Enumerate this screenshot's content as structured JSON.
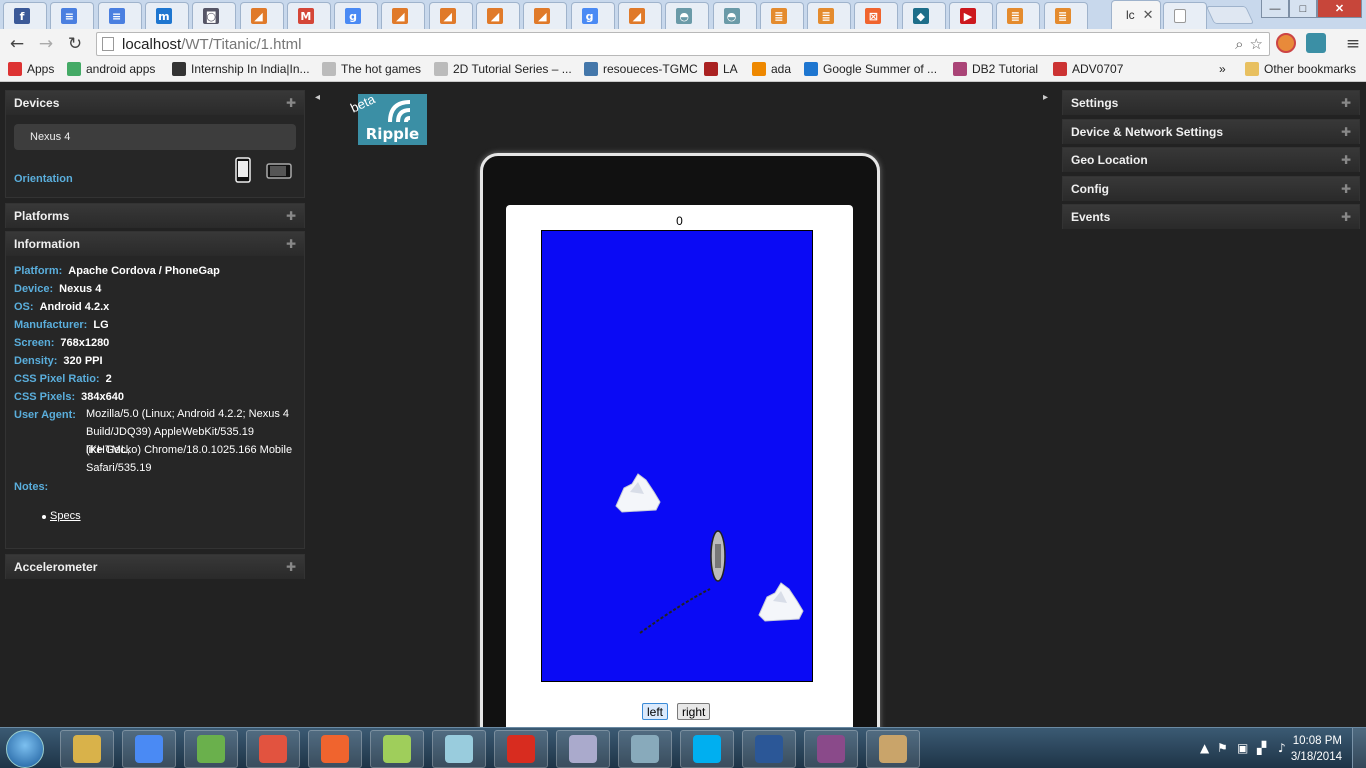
{
  "window": {
    "active_tab_title": "lc",
    "controls": {
      "minimize": "—",
      "maximize": "□",
      "close": "✕"
    }
  },
  "tabs": [
    {
      "icon": "facebook-icon",
      "color": "#3b5998",
      "glyph": "f"
    },
    {
      "icon": "docs-icon",
      "color": "#4a7fe0",
      "glyph": "≡"
    },
    {
      "icon": "docs-icon",
      "color": "#4a7fe0",
      "glyph": "≡"
    },
    {
      "icon": "m-icon",
      "color": "#1e76d0",
      "glyph": "m"
    },
    {
      "icon": "download-icon",
      "color": "#556",
      "glyph": "◙"
    },
    {
      "icon": "blogger-icon",
      "color": "#e07a2a",
      "glyph": "◢"
    },
    {
      "icon": "gmail-icon",
      "color": "#d44638",
      "glyph": "M"
    },
    {
      "icon": "google-icon",
      "color": "#4a8af4",
      "glyph": "g"
    },
    {
      "icon": "blogger-icon",
      "color": "#e07a2a",
      "glyph": "◢"
    },
    {
      "icon": "blogger-icon",
      "color": "#e07a2a",
      "glyph": "◢"
    },
    {
      "icon": "blogger-icon",
      "color": "#e07a2a",
      "glyph": "◢"
    },
    {
      "icon": "blogger-icon",
      "color": "#e07a2a",
      "glyph": "◢"
    },
    {
      "icon": "google-icon",
      "color": "#4a8af4",
      "glyph": "g"
    },
    {
      "icon": "blogger-icon",
      "color": "#e07a2a",
      "glyph": "◢"
    },
    {
      "icon": "ripple-icon",
      "color": "#6a9aa8",
      "glyph": "◓"
    },
    {
      "icon": "ripple-icon",
      "color": "#6a9aa8",
      "glyph": "◓"
    },
    {
      "icon": "stackoverflow-icon",
      "color": "#e48b2e",
      "glyph": "≣"
    },
    {
      "icon": "stackoverflow-icon",
      "color": "#e48b2e",
      "glyph": "≣"
    },
    {
      "icon": "xampp-icon",
      "color": "#f0642e",
      "glyph": "⊠"
    },
    {
      "icon": "app-icon",
      "color": "#1d6e8a",
      "glyph": "◆"
    },
    {
      "icon": "youtube-icon",
      "color": "#cc181e",
      "glyph": "▶"
    },
    {
      "icon": "stackoverflow-icon",
      "color": "#e48b2e",
      "glyph": "≣"
    },
    {
      "icon": "stackoverflow-icon",
      "color": "#e48b2e",
      "glyph": "≣"
    }
  ],
  "toolbar": {
    "url_host": "localhost",
    "url_path": "/WT/Titanic/1.html"
  },
  "bookmarks": [
    {
      "label": "Apps",
      "icon": "apps-grid-icon",
      "color": "#d33"
    },
    {
      "label": "android apps",
      "icon": "android-icon",
      "color": "#4a6"
    },
    {
      "label": "Internship In India|In...",
      "icon": "arrow-icon",
      "color": "#333"
    },
    {
      "label": "The hot games",
      "icon": "page-icon",
      "color": "#bbb"
    },
    {
      "label": "2D Tutorial Series – ...",
      "icon": "page-icon",
      "color": "#bbb"
    },
    {
      "label": "resoueces-TGMC",
      "icon": "ibm-icon",
      "color": "#47a"
    },
    {
      "label": "LA",
      "icon": "mit-icon",
      "color": "#a22"
    },
    {
      "label": "ada",
      "icon": "windows-icon",
      "color": "#e80"
    },
    {
      "label": "Google Summer of ...",
      "icon": "m-icon",
      "color": "#1e76d0"
    },
    {
      "label": "DB2 Tutorial",
      "icon": "db2-icon",
      "color": "#a47"
    },
    {
      "label": "ADV0707",
      "icon": "diamond-icon",
      "color": "#c33"
    }
  ],
  "bookmarks_overflow": "»",
  "other_bookmarks": "Other bookmarks",
  "left_panels": {
    "devices": {
      "title": "Devices",
      "selected_device": "Nexus 4",
      "orientation_label": "Orientation"
    },
    "platforms": {
      "title": "Platforms"
    },
    "information": {
      "title": "Information",
      "rows": [
        {
          "key": "Platform:",
          "value": "Apache Cordova / PhoneGap"
        },
        {
          "key": "Device:",
          "value": "Nexus 4"
        },
        {
          "key": "OS:",
          "value": "Android 4.2.x"
        },
        {
          "key": "Manufacturer:",
          "value": "LG"
        },
        {
          "key": "Screen:",
          "value": "768x1280"
        },
        {
          "key": "Density:",
          "value": "320 PPI"
        },
        {
          "key": "CSS Pixel Ratio:",
          "value": "2"
        },
        {
          "key": "CSS Pixels:",
          "value": "384x640"
        }
      ],
      "user_agent_key": "User Agent:",
      "user_agent_lines": [
        "Mozilla/5.0 (Linux; Android 4.2.2; Nexus 4",
        "Build/JDQ39) AppleWebKit/535.19 (KHTML,",
        "like Gecko) Chrome/18.0.1025.166 Mobile",
        "Safari/535.19"
      ],
      "notes_key": "Notes:",
      "specs_link": "Specs"
    },
    "accelerometer": {
      "title": "Accelerometer"
    }
  },
  "right_panels": [
    {
      "title": "Settings"
    },
    {
      "title": "Device & Network Settings"
    },
    {
      "title": "Geo Location"
    },
    {
      "title": "Config"
    },
    {
      "title": "Events"
    }
  ],
  "logo": {
    "text": "Ripple",
    "badge": "beta"
  },
  "game": {
    "score": "0",
    "left_button": "left",
    "right_button": "right",
    "ocean_color": "#0a0af5"
  },
  "taskbar": {
    "apps": [
      {
        "icon": "explorer-icon",
        "color": "#d9b24a"
      },
      {
        "icon": "chrome-icon",
        "color": "#4a8af4"
      },
      {
        "icon": "utorrent-icon",
        "color": "#6ab04c"
      },
      {
        "icon": "git-icon",
        "color": "#e2533f"
      },
      {
        "icon": "xampp-icon",
        "color": "#f0642e"
      },
      {
        "icon": "notepad-plus-icon",
        "color": "#9fce5b"
      },
      {
        "icon": "sticky-notes-icon",
        "color": "#9cd"
      },
      {
        "icon": "acrobat-icon",
        "color": "#d82c1f"
      },
      {
        "icon": "calculator-icon",
        "color": "#aac"
      },
      {
        "icon": "virtualbox-icon",
        "color": "#8ab"
      },
      {
        "icon": "skype-icon",
        "color": "#00aff0"
      },
      {
        "icon": "word-icon",
        "color": "#2b5797"
      },
      {
        "icon": "winrar-icon",
        "color": "#8a4a8a"
      },
      {
        "icon": "paint-icon",
        "color": "#c9a46a"
      }
    ],
    "time": "10:08 PM",
    "date": "3/18/2014"
  }
}
